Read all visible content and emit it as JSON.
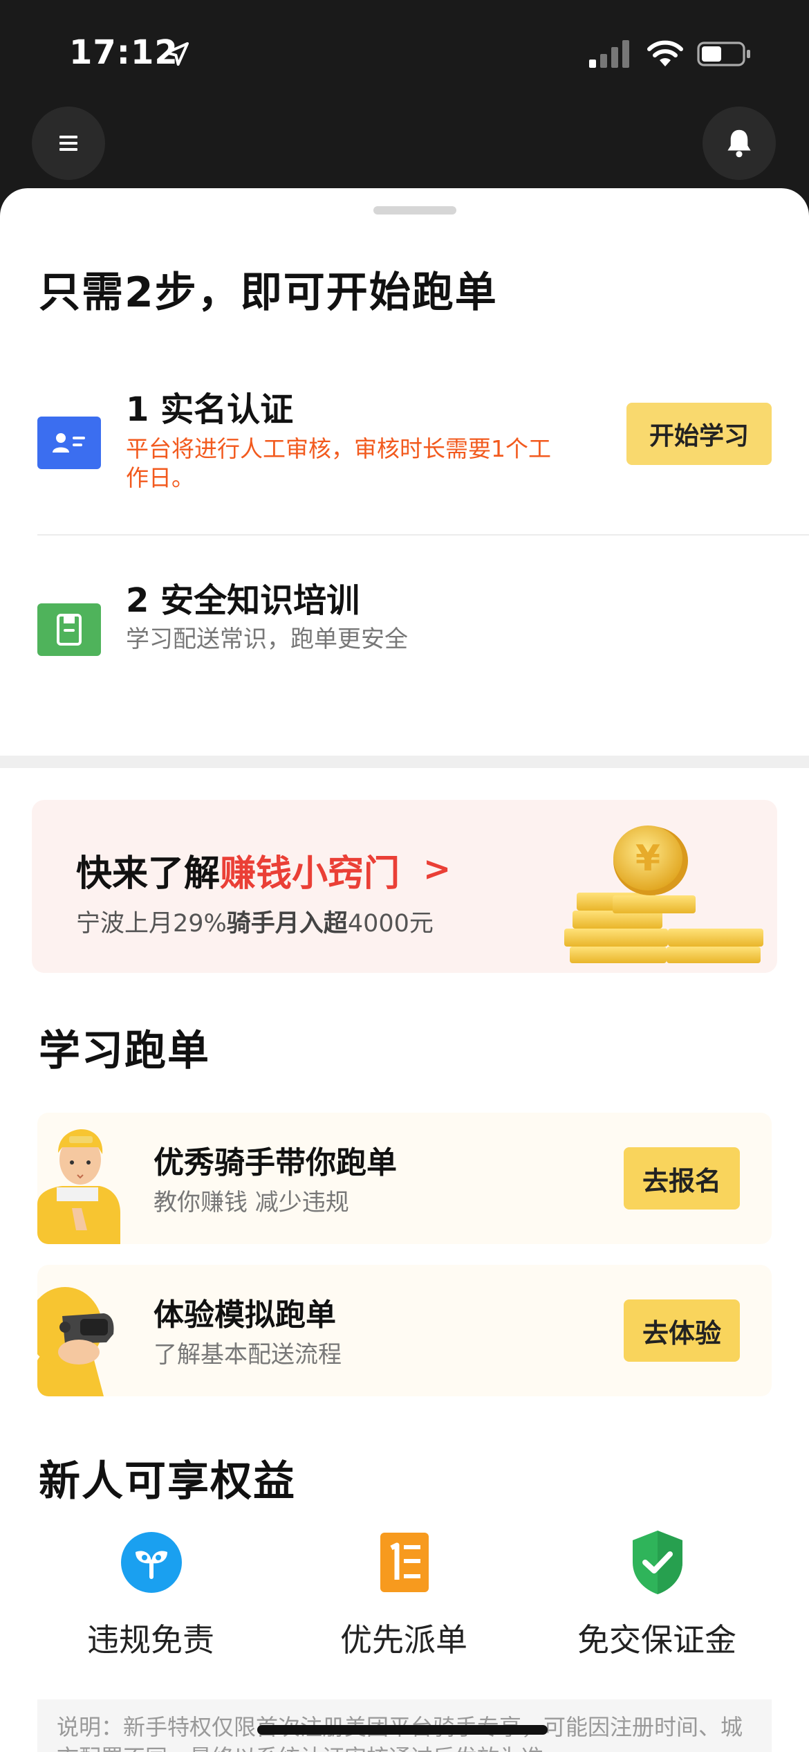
{
  "status_bar": {
    "time": "17:12"
  },
  "sheet": {
    "title": "只需2步，即可开始跑单",
    "steps": [
      {
        "title": "1 实名认证",
        "desc": "平台将进行人工审核，审核时长需要1个工作日。"
      },
      {
        "title": "2 安全知识培训",
        "desc": "学习配送常识，跑单更安全",
        "button": "开始学习"
      }
    ]
  },
  "promo": {
    "title_prefix": "快来了解",
    "title_highlight": "赚钱小窍门",
    "arrow": ">",
    "sub_prefix": "宁波上月29%",
    "sub_bold": "骑手月入超",
    "sub_suffix": "4000元"
  },
  "learn": {
    "title": "学习跑单",
    "cards": [
      {
        "title": "优秀骑手带你跑单",
        "desc": "教你赚钱 减少违规",
        "button": "去报名"
      },
      {
        "title": "体验模拟跑单",
        "desc": "了解基本配送流程",
        "button": "去体验"
      }
    ]
  },
  "benefits": {
    "title": "新人可享权益",
    "items": [
      {
        "label": "违规免责",
        "icon": "sprout-icon",
        "color": "#1aa0f0"
      },
      {
        "label": "优先派单",
        "icon": "priority-dispatch-icon",
        "color": "#f79a1e"
      },
      {
        "label": "免交保证金",
        "icon": "shield-check-icon",
        "color": "#2fb45a"
      }
    ]
  },
  "notice": "说明：新手特权仅限首次注册美团平台骑手专享，可能因注册时间、城市配置不同，最终以系统认证审核通过后发放为准",
  "colors": {
    "accent_yellow": "#f9d96e",
    "warning_orange": "#f25a1e",
    "promo_red": "#ea3f36",
    "step1_blue": "#3b6ef0",
    "step2_green": "#4fb35b"
  }
}
